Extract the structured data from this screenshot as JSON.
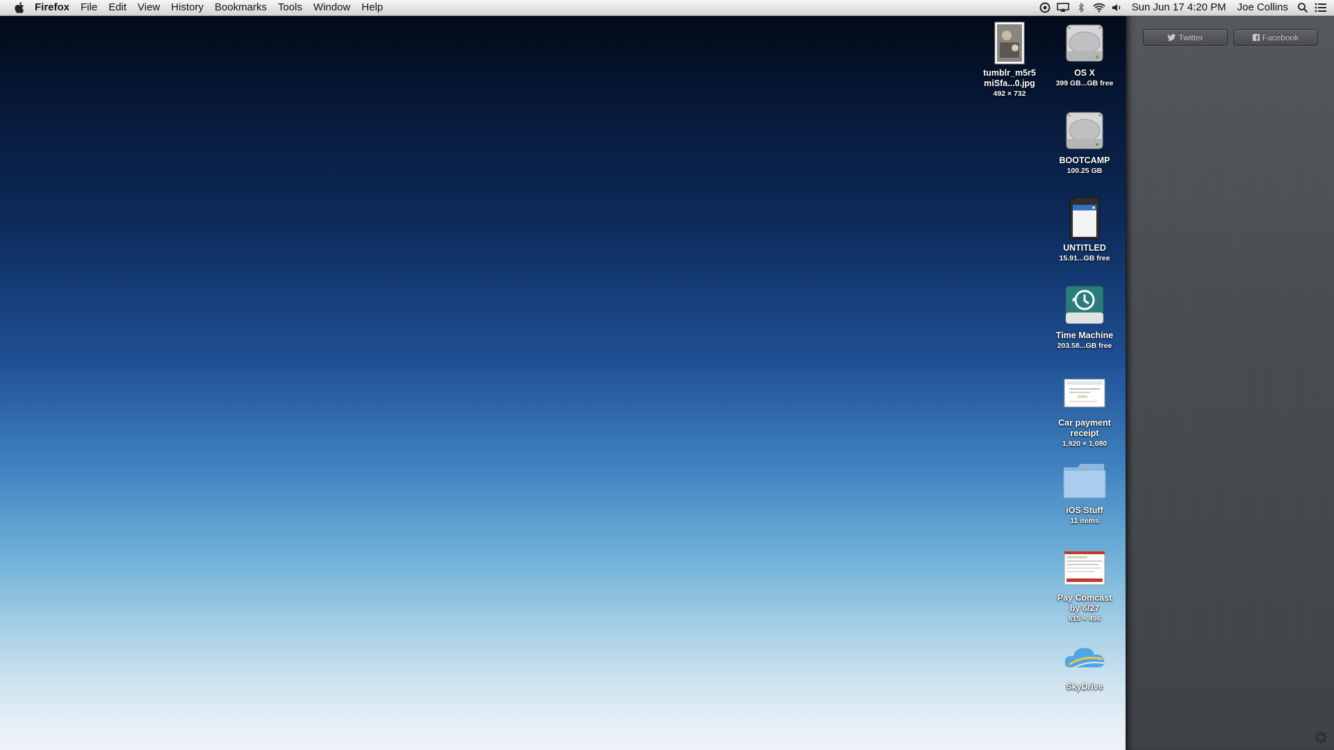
{
  "menubar": {
    "app_name": "Firefox",
    "menus": [
      "File",
      "Edit",
      "View",
      "History",
      "Bookmarks",
      "Tools",
      "Window",
      "Help"
    ],
    "status_icons": [
      "sync-icon",
      "airplay-icon",
      "bluetooth-icon",
      "wifi-icon",
      "volume-icon"
    ],
    "clock": "Sun Jun 17  4:20 PM",
    "user": "Joe Collins",
    "right_icons": [
      "spotlight-icon",
      "notification-center-icon"
    ]
  },
  "desktop_icons": [
    {
      "name": "tumblr_m5r5\nmiSfa...0.jpg",
      "label1": "tumblr_m5r5",
      "label2": "miSfa...0.jpg",
      "sub": "492 × 732",
      "icon": "image-file-icon"
    },
    {
      "label1": "OS X",
      "sub": "399 GB...GB free",
      "icon": "hard-drive-icon"
    },
    {
      "label1": "BOOTCAMP",
      "sub": "100.25 GB",
      "icon": "hard-drive-icon"
    },
    {
      "label1": "UNTITLED",
      "sub": "15.91...GB free",
      "icon": "sd-card-icon"
    },
    {
      "label1": "Time Machine",
      "sub": "203.58...GB free",
      "icon": "time-machine-drive-icon"
    },
    {
      "label1": "Car payment",
      "label2": "receipt",
      "sub": "1,920 × 1,080",
      "icon": "screenshot-file-icon"
    },
    {
      "label1": "iOS Stuff",
      "sub": "11 items",
      "icon": "folder-icon"
    },
    {
      "label1": "Pay Comcast",
      "label2": "by 6/27",
      "sub": "615 × 496",
      "icon": "webpage-screenshot-icon"
    },
    {
      "label1": "SkyDrive",
      "icon": "skydrive-icon"
    }
  ],
  "notification_center": {
    "twitter_label": "Twitter",
    "facebook_label": "Facebook"
  },
  "colors": {
    "wallpaper_top": "#020713",
    "wallpaper_mid": "#1f4f94",
    "wallpaper_bottom": "#eef4f9",
    "notification_bg": "#4a4d52"
  }
}
